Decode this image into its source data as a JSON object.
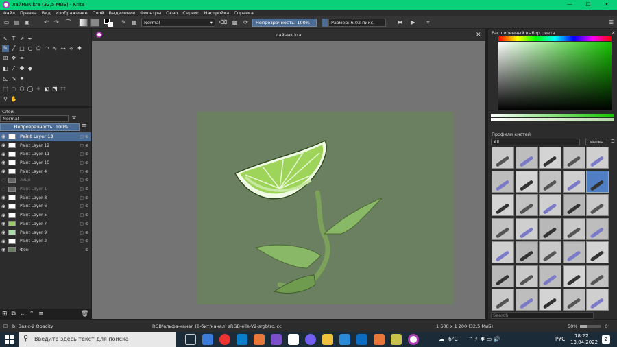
{
  "window": {
    "title": "лаймик.kra (32,5 МиБ)  - Krita",
    "controls": [
      "—",
      "☐",
      "✕"
    ]
  },
  "menu": [
    "Файл",
    "Правка",
    "Вид",
    "Изображение",
    "Слой",
    "Выделение",
    "Фильтры",
    "Окно",
    "Сервис",
    "Настройка",
    "Справка"
  ],
  "toolbar": {
    "blend_mode": "Normal",
    "opacity_label": "Непрозрачность: 100%",
    "size_label": "Размер: 6,02 пикс."
  },
  "document": {
    "tab_title": "лайник.kra"
  },
  "layers": {
    "panel_title": "Слои",
    "blend_mode": "Normal",
    "opacity_label": "Непрозрачность:  100%",
    "items": [
      {
        "name": "Paint Layer 13",
        "selected": true,
        "visible": true
      },
      {
        "name": "Paint Layer 12",
        "visible": true
      },
      {
        "name": "Paint Layer 11",
        "visible": true
      },
      {
        "name": "Paint Layer 10",
        "visible": true
      },
      {
        "name": "Paint Layer 4",
        "visible": true
      },
      {
        "name": "лицо",
        "visible": false
      },
      {
        "name": "Paint Layer 1",
        "visible": false
      },
      {
        "name": "Paint Layer 8",
        "visible": true
      },
      {
        "name": "Paint Layer 6",
        "visible": true
      },
      {
        "name": "Paint Layer 5",
        "visible": true
      },
      {
        "name": "Paint Layer 7",
        "visible": true
      },
      {
        "name": "Paint Layer 9",
        "visible": true
      },
      {
        "name": "Paint Layer 2",
        "visible": true
      },
      {
        "name": "Фон",
        "visible": true
      }
    ]
  },
  "color_panel": {
    "title": "Расширенный выбор цвета"
  },
  "brushes": {
    "title": "Профили кистей",
    "filter": "All",
    "tag_label": "Метка",
    "search_placeholder": "Search"
  },
  "status": {
    "brush_name": "b) Basic-2 Opacity",
    "color_space": "RGB/альфа-канал (8-бит/канал)  sRGB-elle-V2-srgbtrc.icc",
    "dimensions": "1 600 x 1 200 (32,5 МиБ)",
    "zoom": "50%"
  },
  "taskbar": {
    "search_placeholder": "Введите здесь текст для поиска",
    "weather": "6°C",
    "lang": "РУС",
    "time": "18:22",
    "date": "13.04.2022",
    "notif_count": "2"
  },
  "colors": {
    "title_bar": "#0ad07a",
    "accent": "#4a6b93",
    "canvas_bg": "#6b8060"
  }
}
